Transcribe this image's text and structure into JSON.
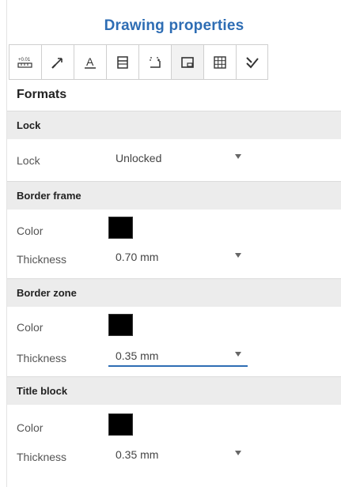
{
  "panel": {
    "title": "Drawing properties"
  },
  "toolbar": {
    "buttons": [
      {
        "icon": "tolerance-icon",
        "text": "+0.01"
      },
      {
        "icon": "arrow-icon"
      },
      {
        "icon": "text-icon",
        "text": "A"
      },
      {
        "icon": "table-format-icon"
      },
      {
        "icon": "dimension-icon"
      },
      {
        "icon": "drawing-format-icon",
        "active": true
      },
      {
        "icon": "grid-icon"
      },
      {
        "icon": "check-icon"
      }
    ]
  },
  "formats_label": "Formats",
  "sections": {
    "lock": {
      "title": "Lock",
      "lock_label": "Lock",
      "lock_value": "Unlocked"
    },
    "border_frame": {
      "title": "Border frame",
      "color_label": "Color",
      "color": "#000000",
      "thickness_label": "Thickness",
      "thickness_value": "0.70 mm"
    },
    "border_zone": {
      "title": "Border zone",
      "color_label": "Color",
      "color": "#000000",
      "thickness_label": "Thickness",
      "thickness_value": "0.35 mm"
    },
    "title_block": {
      "title": "Title block",
      "color_label": "Color",
      "color": "#000000",
      "thickness_label": "Thickness",
      "thickness_value": "0.35 mm"
    }
  },
  "colors": {
    "accent": "#2e6db4",
    "section_bg": "#ececec"
  }
}
